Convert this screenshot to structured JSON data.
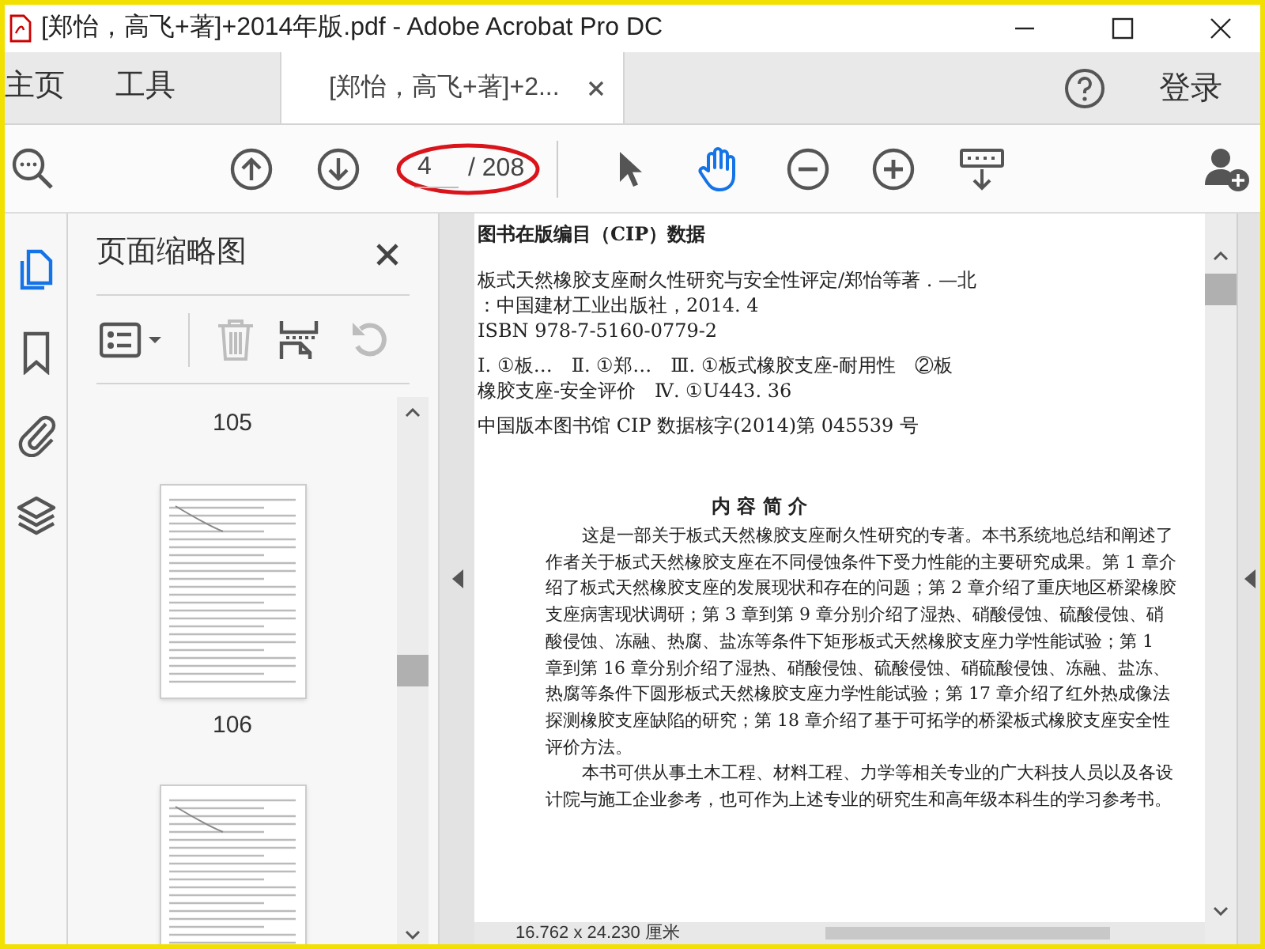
{
  "window": {
    "title": "[郑怡，高飞+著]+2014年版.pdf - Adobe Acrobat Pro DC"
  },
  "tabs": [
    {
      "label": "主页",
      "kind": "menu",
      "selected": false
    },
    {
      "label": "工具",
      "kind": "menu",
      "selected": false
    },
    {
      "label": "[郑怡，高飞+著]+2...",
      "kind": "document",
      "selected": true
    }
  ],
  "account": {
    "label": "登录"
  },
  "toolbar": {
    "page_field": {
      "value": "4",
      "total": "/ 208"
    },
    "tools": [
      {
        "kind": "select",
        "selected": false
      },
      {
        "kind": "hand",
        "selected": true
      }
    ]
  },
  "rail": [
    {
      "kind": "pages",
      "selected": true
    },
    {
      "kind": "bookmark",
      "selected": false
    },
    {
      "kind": "attachment",
      "selected": false
    },
    {
      "kind": "layers",
      "selected": false
    }
  ],
  "panel": {
    "title": "页面缩略图",
    "tools": [
      {
        "kind": "options",
        "disabled": false
      },
      {
        "kind": "delete",
        "disabled": true
      },
      {
        "kind": "insert",
        "disabled": false
      },
      {
        "kind": "rotate",
        "disabled": true
      }
    ],
    "thumbnails": [
      {
        "label": "105",
        "kind": "cut"
      },
      {
        "label": "106",
        "kind": "full"
      },
      {
        "kind": "full"
      }
    ]
  },
  "document": {
    "cip_heading": "图书在版编目（CIP）数据",
    "cip_lines": [
      "板式天然橡胶支座耐久性研究与安全性评定/郑怡等著 . —北",
      "：中国建材工业出版社，2014. 4",
      "ISBN 978-7-5160-0779-2",
      "Ⅰ. ①板…　Ⅱ. ①郑…　Ⅲ. ①板式橡胶支座-耐用性　②板",
      "橡胶支座-安全评价　Ⅳ. ①U443. 36",
      "中国版本图书馆 CIP 数据核字(2014)第 045539 号"
    ],
    "summary_title": "内 容 简 介",
    "summary_lines": [
      {
        "text": "这是一部关于板式天然橡胶支座耐久性研究的专著。本书系统地总结和阐述了",
        "indent": true
      },
      {
        "text": "作者关于板式天然橡胶支座在不同侵蚀条件下受力性能的主要研究成果。第 1 章介",
        "indent": false
      },
      {
        "text": "绍了板式天然橡胶支座的发展现状和存在的问题；第 2 章介绍了重庆地区桥梁橡胶",
        "indent": false
      },
      {
        "text": "支座病害现状调研；第 3 章到第 9 章分别介绍了湿热、硝酸侵蚀、硫酸侵蚀、硝",
        "indent": false
      },
      {
        "text": "酸侵蚀、冻融、热腐、盐冻等条件下矩形板式天然橡胶支座力学性能试验；第 1",
        "indent": false
      },
      {
        "text": "章到第 16 章分别介绍了湿热、硝酸侵蚀、硫酸侵蚀、硝硫酸侵蚀、冻融、盐冻、",
        "indent": false
      },
      {
        "text": "热腐等条件下圆形板式天然橡胶支座力学性能试验；第 17 章介绍了红外热成像法",
        "indent": false
      },
      {
        "text": "探测橡胶支座缺陷的研究；第 18 章介绍了基于可拓学的桥梁板式橡胶支座安全性",
        "indent": false
      },
      {
        "text": "评价方法。",
        "indent": false
      },
      {
        "text": "本书可供从事土木工程、材料工程、力学等相关专业的广大科技人员以及各设",
        "indent": true
      },
      {
        "text": "计院与施工企业参考，也可作为上述专业的研究生和高年级本科生的学习参考书。",
        "indent": false
      }
    ],
    "page_size": "16.762 x 24.230 厘米"
  }
}
